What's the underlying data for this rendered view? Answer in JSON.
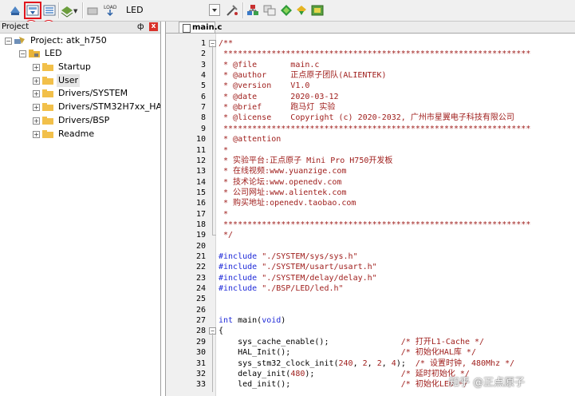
{
  "toolbar": {
    "target_name": "LED",
    "markers": [
      "①",
      "②"
    ]
  },
  "project": {
    "title": "Project",
    "pin": "ф",
    "close": "x",
    "tree": [
      {
        "label": "Project: atk_h750",
        "level": 0,
        "expander": "minus",
        "icon": "project-icon"
      },
      {
        "label": "LED",
        "level": 1,
        "expander": "minus",
        "icon": "target-folder-icon"
      },
      {
        "label": "Startup",
        "level": 2,
        "expander": "plus",
        "icon": "folder-icon"
      },
      {
        "label": "User",
        "level": 2,
        "expander": "plus",
        "icon": "folder-icon",
        "selected": true
      },
      {
        "label": "Drivers/SYSTEM",
        "level": 2,
        "expander": "plus",
        "icon": "folder-icon"
      },
      {
        "label": "Drivers/STM32H7xx_HAL_Dri",
        "level": 2,
        "expander": "plus",
        "icon": "folder-icon"
      },
      {
        "label": "Drivers/BSP",
        "level": 2,
        "expander": "plus",
        "icon": "folder-icon"
      },
      {
        "label": "Readme",
        "level": 2,
        "expander": "plus",
        "icon": "folder-icon"
      }
    ]
  },
  "editor": {
    "tab_label": "main.c",
    "lines": [
      {
        "n": 1,
        "fold": "minus",
        "parts": [
          [
            "cm",
            "/**"
          ]
        ]
      },
      {
        "n": 2,
        "parts": [
          [
            "cm",
            " ****************************************************************"
          ]
        ]
      },
      {
        "n": 3,
        "parts": [
          [
            "cm",
            " * @file       main.c"
          ]
        ]
      },
      {
        "n": 4,
        "parts": [
          [
            "cm",
            " * @author     正点原子团队(ALIENTEK)"
          ]
        ]
      },
      {
        "n": 5,
        "parts": [
          [
            "cm",
            " * @version    V1.0"
          ]
        ]
      },
      {
        "n": 6,
        "parts": [
          [
            "cm",
            " * @date       2020-03-12"
          ]
        ]
      },
      {
        "n": 7,
        "parts": [
          [
            "cm",
            " * @brief      跑马灯 实验"
          ]
        ]
      },
      {
        "n": 8,
        "parts": [
          [
            "cm",
            " * @license    Copyright (c) 2020-2032, 广州市星翼电子科技有限公司"
          ]
        ]
      },
      {
        "n": 9,
        "parts": [
          [
            "cm",
            " ****************************************************************"
          ]
        ]
      },
      {
        "n": 10,
        "parts": [
          [
            "cm",
            " * @attention"
          ]
        ]
      },
      {
        "n": 11,
        "parts": [
          [
            "cm",
            " *"
          ]
        ]
      },
      {
        "n": 12,
        "parts": [
          [
            "cm",
            " * 实验平台:正点原子 Mini Pro H750开发板"
          ]
        ]
      },
      {
        "n": 13,
        "parts": [
          [
            "cm",
            " * 在线视频:www.yuanzige.com"
          ]
        ]
      },
      {
        "n": 14,
        "parts": [
          [
            "cm",
            " * 技术论坛:www.openedv.com"
          ]
        ]
      },
      {
        "n": 15,
        "parts": [
          [
            "cm",
            " * 公司网址:www.alientek.com"
          ]
        ]
      },
      {
        "n": 16,
        "parts": [
          [
            "cm",
            " * 购买地址:openedv.taobao.com"
          ]
        ]
      },
      {
        "n": 17,
        "parts": [
          [
            "cm",
            " *"
          ]
        ]
      },
      {
        "n": 18,
        "parts": [
          [
            "cm",
            " ****************************************************************"
          ]
        ]
      },
      {
        "n": 19,
        "parts": [
          [
            "cm",
            " */"
          ]
        ]
      },
      {
        "n": 20,
        "parts": []
      },
      {
        "n": 21,
        "parts": [
          [
            "pp",
            "#include "
          ],
          [
            "str",
            "\"./SYSTEM/sys/sys.h\""
          ]
        ]
      },
      {
        "n": 22,
        "parts": [
          [
            "pp",
            "#include "
          ],
          [
            "str",
            "\"./SYSTEM/usart/usart.h\""
          ]
        ]
      },
      {
        "n": 23,
        "parts": [
          [
            "pp",
            "#include "
          ],
          [
            "str",
            "\"./SYSTEM/delay/delay.h\""
          ]
        ]
      },
      {
        "n": 24,
        "parts": [
          [
            "pp",
            "#include "
          ],
          [
            "str",
            "\"./BSP/LED/led.h\""
          ]
        ]
      },
      {
        "n": 25,
        "parts": []
      },
      {
        "n": 26,
        "parts": []
      },
      {
        "n": 27,
        "parts": [
          [
            "kw",
            "int"
          ],
          [
            "tx",
            " main("
          ],
          [
            "kw",
            "void"
          ],
          [
            "tx",
            ")"
          ]
        ]
      },
      {
        "n": 28,
        "fold": "minus",
        "parts": [
          [
            "tx",
            "{"
          ]
        ]
      },
      {
        "n": 29,
        "parts": [
          [
            "tx",
            "    sys_cache_enable();               "
          ],
          [
            "cm",
            "/* 打开L1-Cache */"
          ]
        ]
      },
      {
        "n": 30,
        "parts": [
          [
            "tx",
            "    HAL_Init();                       "
          ],
          [
            "cm",
            "/* 初始化HAL库 */"
          ]
        ]
      },
      {
        "n": 31,
        "parts": [
          [
            "tx",
            "    sys_stm32_clock_init("
          ],
          [
            "num",
            "240"
          ],
          [
            "tx",
            ", "
          ],
          [
            "num",
            "2"
          ],
          [
            "tx",
            ", "
          ],
          [
            "num",
            "2"
          ],
          [
            "tx",
            ", "
          ],
          [
            "num",
            "4"
          ],
          [
            "tx",
            ");  "
          ],
          [
            "cm",
            "/* 设置时钟, 480Mhz */"
          ]
        ]
      },
      {
        "n": 32,
        "parts": [
          [
            "tx",
            "    delay_init("
          ],
          [
            "num",
            "480"
          ],
          [
            "tx",
            ");                  "
          ],
          [
            "cm",
            "/* 延时初始化 */"
          ]
        ]
      },
      {
        "n": 33,
        "parts": [
          [
            "tx",
            "    led_init();                       "
          ],
          [
            "cm",
            "/* 初始化LED */"
          ]
        ]
      }
    ]
  },
  "watermark": "知乎 @正点原子"
}
